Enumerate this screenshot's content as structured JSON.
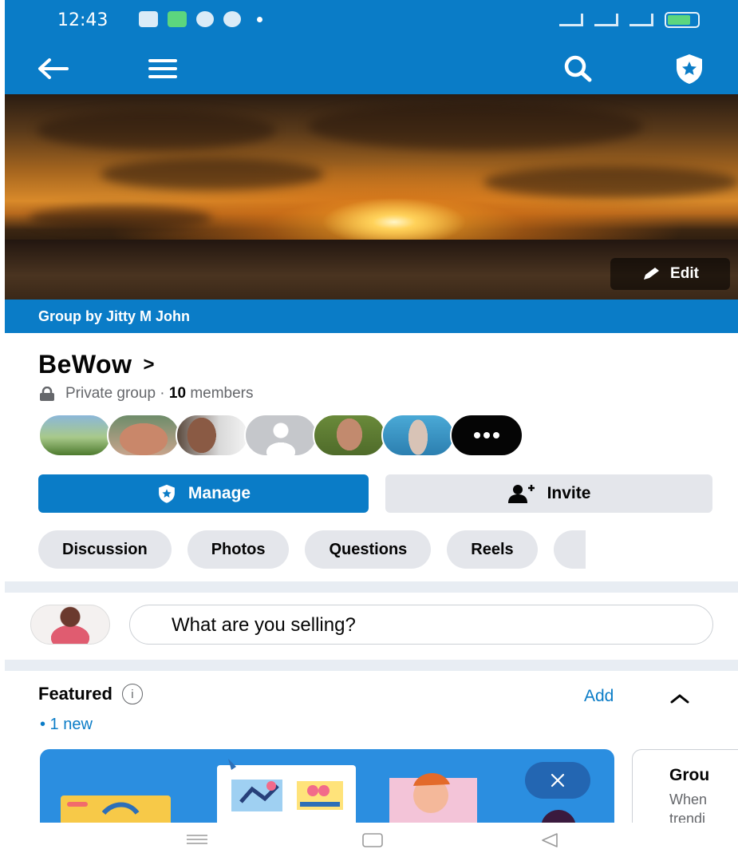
{
  "status_bar": {
    "time": "12:43"
  },
  "cover": {
    "edit_label": "Edit"
  },
  "group": {
    "byline": "Group by Jitty M John",
    "name": "BeWow",
    "privacy": "Private group ·",
    "member_count": "10",
    "members_label": "members"
  },
  "actions": {
    "manage_label": "Manage",
    "invite_label": "Invite"
  },
  "tabs": [
    {
      "label": "Discussion"
    },
    {
      "label": "Photos"
    },
    {
      "label": "Questions"
    },
    {
      "label": "Reels"
    }
  ],
  "composer": {
    "placeholder": "What are you selling?"
  },
  "featured": {
    "title": "Featured",
    "new_count": "• 1 new",
    "add_label": "Add"
  },
  "side_card": {
    "title": "Grou",
    "desc_line1": "When",
    "desc_line2": "trendi"
  },
  "colors": {
    "brand": "#0a7cc7",
    "chip_bg": "#e4e6eb",
    "muted": "#65676b"
  }
}
